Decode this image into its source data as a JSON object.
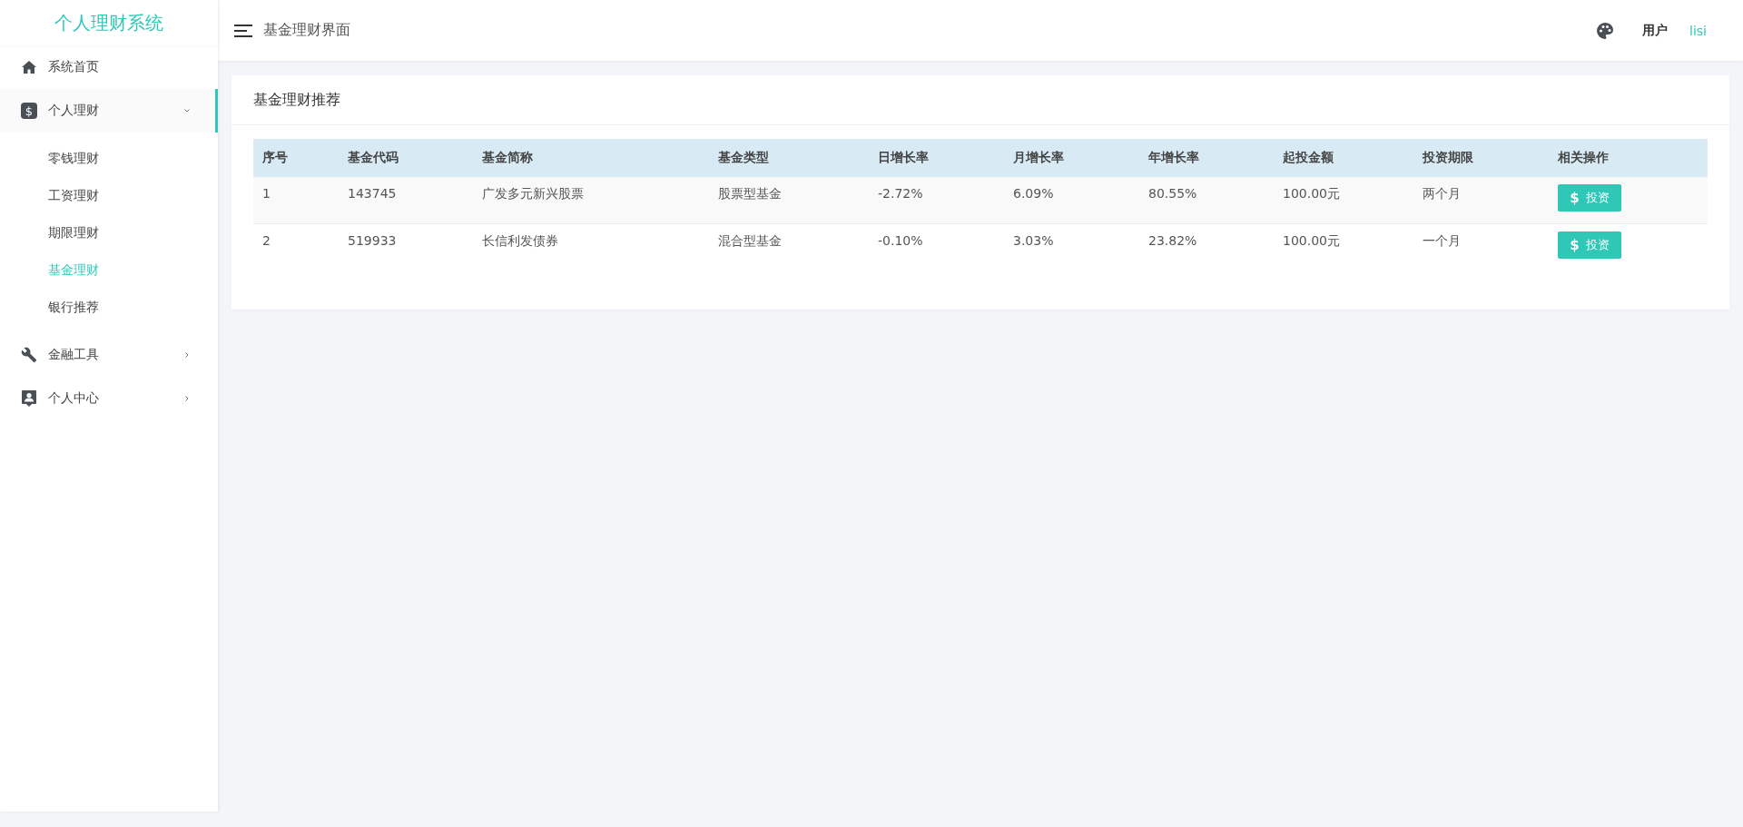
{
  "app": {
    "title": "个人理财系统"
  },
  "sidebar": {
    "items": [
      {
        "kind": "link",
        "label": "系统首页",
        "selected": false
      },
      {
        "kind": "group",
        "icon_text": "$",
        "label": "个人理财",
        "selected": true,
        "expanded": true,
        "children": [
          {
            "label": "零钱理财",
            "selected": false
          },
          {
            "label": "工资理财",
            "selected": false
          },
          {
            "label": "期限理财",
            "selected": false
          },
          {
            "label": "基金理财",
            "selected": true
          },
          {
            "label": "银行推荐",
            "selected": false
          }
        ]
      },
      {
        "kind": "group",
        "label": "金融工具",
        "selected": false,
        "expanded": false
      },
      {
        "kind": "group",
        "label": "个人中心",
        "selected": false,
        "expanded": false
      }
    ]
  },
  "header": {
    "page_title": "基金理财界面",
    "user_label": "用户",
    "user_name": "lisi"
  },
  "card": {
    "title": "基金理财推荐",
    "table": {
      "columns": [
        "序号",
        "基金代码",
        "基金简称",
        "基金类型",
        "日增长率",
        "月增长率",
        "年增长率",
        "起投金额",
        "投资期限",
        "相关操作"
      ],
      "rows": [
        {
          "cells": [
            "1",
            "143745",
            "广发多元新兴股票",
            "股票型基金",
            "-2.72%",
            "6.09%",
            "80.55%",
            "100.00元",
            "两个月"
          ],
          "action": {
            "icon_text": "$",
            "label": "投资"
          }
        },
        {
          "cells": [
            "2",
            "519933",
            "长信利发债券",
            "混合型基金",
            "-0.10%",
            "3.03%",
            "23.82%",
            "100.00元",
            "一个月"
          ],
          "action": {
            "icon_text": "$",
            "label": "投资"
          }
        }
      ]
    }
  }
}
